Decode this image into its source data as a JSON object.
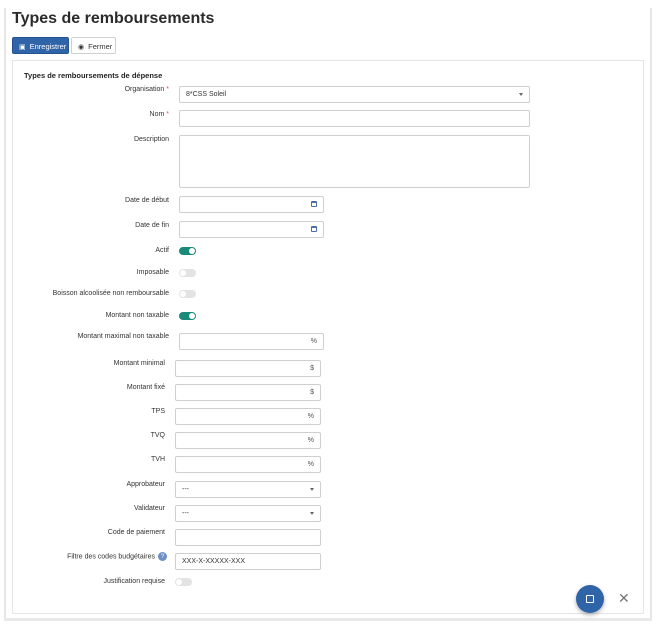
{
  "header": {
    "title": "Types de remboursements"
  },
  "toolbar": {
    "save_label": "Enregistrer",
    "close_label": "Fermer"
  },
  "form": {
    "section_title": "Types de remboursements de dépense",
    "organisation": {
      "label": "Organisation",
      "required_mark": "*",
      "value": "8*CSS Soleil"
    },
    "nom": {
      "label": "Nom",
      "required_mark": "*",
      "value": ""
    },
    "description": {
      "label": "Description",
      "value": ""
    },
    "date_debut": {
      "label": "Date de début",
      "value": ""
    },
    "date_fin": {
      "label": "Date de fin",
      "value": ""
    },
    "actif": {
      "label": "Actif",
      "checked": true
    },
    "imposable": {
      "label": "Imposable",
      "checked": false
    },
    "boisson": {
      "label": "Boisson alcoolisée non remboursable",
      "checked": false
    },
    "montant_non_taxable": {
      "label": "Montant non taxable",
      "checked": true
    },
    "montant_max_non_taxable": {
      "label": "Montant maximal non taxable",
      "suffix": "%",
      "value": ""
    },
    "montant_minimal": {
      "label": "Montant minimal",
      "suffix": "$",
      "value": ""
    },
    "montant_fixe": {
      "label": "Montant fixé",
      "suffix": "$",
      "value": ""
    },
    "tps": {
      "label": "TPS",
      "suffix": "%",
      "value": ""
    },
    "tvq": {
      "label": "TVQ",
      "suffix": "%",
      "value": ""
    },
    "tvh": {
      "label": "TVH",
      "suffix": "%",
      "value": ""
    },
    "approbateur": {
      "label": "Approbateur",
      "value": "---"
    },
    "validateur": {
      "label": "Validateur",
      "value": "---"
    },
    "code_paiement": {
      "label": "Code de paiement",
      "value": ""
    },
    "filtre_codes": {
      "label": "Filtre des codes budgétaires",
      "help": "?",
      "value": "XXX-X-XXXXX-XXX"
    },
    "justification": {
      "label": "Justification requise",
      "checked": false
    }
  },
  "footer": {
    "close_symbol": "✕"
  },
  "colors": {
    "primary": "#2f64a8",
    "toggle_on": "#1a8a7a",
    "required": "#d9534f"
  }
}
